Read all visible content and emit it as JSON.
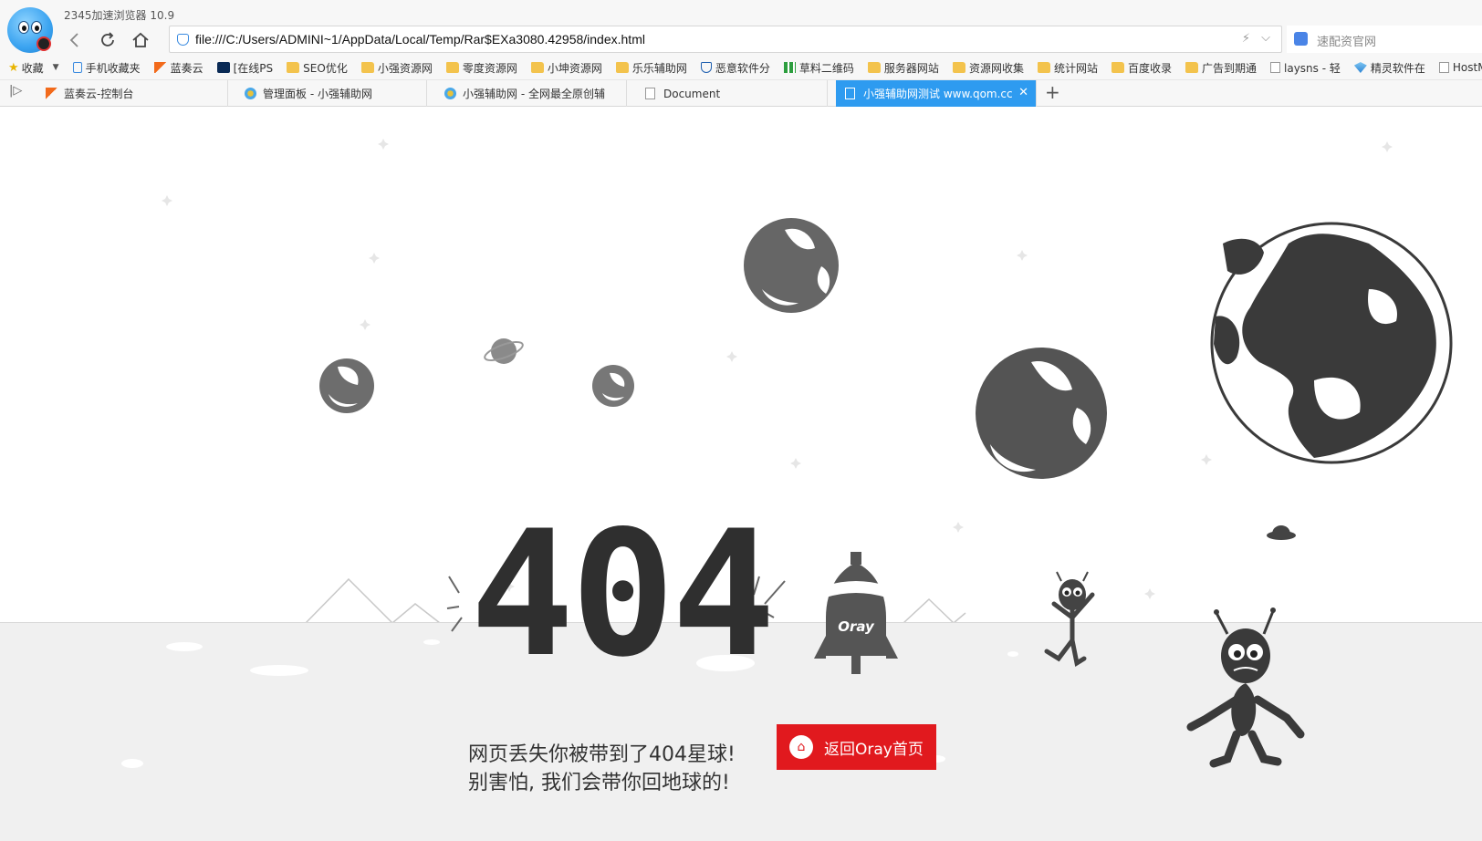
{
  "browser": {
    "app_title": "2345加速浏览器 10.9",
    "address_url": "file:///C:/Users/ADMINI~1/AppData/Local/Temp/Rar$EXa3080.42958/index.html",
    "search_placeholder": "速配资官网"
  },
  "bookmarks": [
    {
      "label": "收藏",
      "icon": "star-icon"
    },
    {
      "label": "手机收藏夹",
      "icon": "phone-icon"
    },
    {
      "label": "蓝奏云",
      "icon": "flag-icon"
    },
    {
      "label": "[在线PS",
      "icon": "ps-icon"
    },
    {
      "label": "SEO优化",
      "icon": "folder-icon"
    },
    {
      "label": "小强资源网",
      "icon": "folder-icon"
    },
    {
      "label": "零度资源网",
      "icon": "folder-icon"
    },
    {
      "label": "小坤资源网",
      "icon": "folder-icon"
    },
    {
      "label": "乐乐辅助网",
      "icon": "folder-icon"
    },
    {
      "label": "恶意软件分",
      "icon": "shield-icon"
    },
    {
      "label": "草料二维码",
      "icon": "qr-icon"
    },
    {
      "label": "服务器网站",
      "icon": "folder-icon"
    },
    {
      "label": "资源网收集",
      "icon": "folder-icon"
    },
    {
      "label": "统计网站",
      "icon": "folder-icon"
    },
    {
      "label": "百度收录",
      "icon": "folder-icon"
    },
    {
      "label": "广告到期通",
      "icon": "folder-icon"
    },
    {
      "label": "laysns - 轻",
      "icon": "page-icon"
    },
    {
      "label": "精灵软件在",
      "icon": "gem-icon"
    },
    {
      "label": "HostMem",
      "icon": "page-icon"
    }
  ],
  "tabs": [
    {
      "label": "蓝奏云-控制台",
      "active": false
    },
    {
      "label": "管理面板 - 小强辅助网",
      "active": false
    },
    {
      "label": "小强辅助网 - 全网最全原创辅",
      "active": false
    },
    {
      "label": "Document",
      "active": false
    },
    {
      "label": "小强辅助网测试 www.qom.cc",
      "active": true
    }
  ],
  "page": {
    "error_code": "404",
    "message_line1": "网页丢失你被带到了404星球!",
    "message_line2": "别害怕, 我们会带你回地球的!",
    "home_button_label": "返回Oray首页",
    "rocket_label": "Oray",
    "accent_color": "#e1191e",
    "ink_color": "#3a3a3a"
  }
}
